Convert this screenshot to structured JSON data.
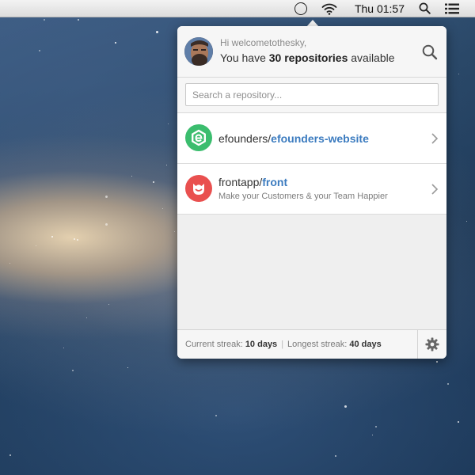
{
  "menubar": {
    "time": "Thu 01:57",
    "icons": [
      "status-circle-icon",
      "wifi-icon",
      "spotlight-search-icon",
      "notification-list-icon"
    ]
  },
  "header": {
    "greeting": "Hi welcometothesky,",
    "count_prefix": "You have ",
    "count_value": "30 repositories",
    "count_suffix": " available",
    "search_icon": "search-icon"
  },
  "search": {
    "placeholder": "Search a repository...",
    "value": ""
  },
  "repositories": [
    {
      "owner": "efounders/",
      "name": "efounders-website",
      "description": "",
      "icon": "efounders-logo-icon",
      "icon_color": "#3bbd6e"
    },
    {
      "owner": "frontapp/",
      "name": "front",
      "description": "Make your Customers & your Team Happier",
      "icon": "front-logo-icon",
      "icon_color": "#e9504f"
    }
  ],
  "footer": {
    "current_label": "Current streak: ",
    "current_value": "10 days",
    "separator": "|",
    "longest_label": "Longest streak: ",
    "longest_value": "40 days",
    "settings_icon": "gear-icon"
  },
  "colors": {
    "link": "#3b7bbf",
    "efounders_green": "#3bbd6e",
    "front_red": "#e9504f"
  }
}
